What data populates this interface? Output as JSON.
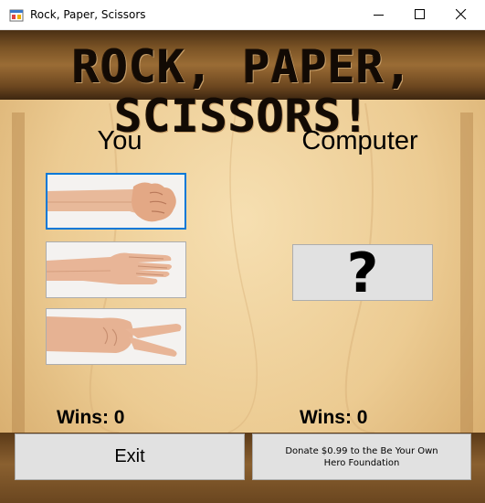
{
  "window": {
    "title": "Rock, Paper, Scissors",
    "controls": [
      "minimize",
      "maximize",
      "close"
    ]
  },
  "banner": {
    "text": "ROCK, PAPER, SCISSORS!"
  },
  "player": {
    "heading": "You",
    "wins_label": "Wins: 0",
    "choices": [
      {
        "name": "rock",
        "icon": "fist-hand-icon",
        "selected": true
      },
      {
        "name": "paper",
        "icon": "flat-hand-icon",
        "selected": false
      },
      {
        "name": "scissors",
        "icon": "peace-hand-icon",
        "selected": false
      }
    ]
  },
  "computer": {
    "heading": "Computer",
    "wins_label": "Wins: 0",
    "choice_glyph": "?"
  },
  "buttons": {
    "exit_label": "Exit",
    "donate_label": "Donate $0.99 to the Be Your Own Hero Foundation"
  },
  "colors": {
    "selection_border": "#0078d7",
    "button_face": "#e1e1e1",
    "background_wood": "#eccb92"
  }
}
